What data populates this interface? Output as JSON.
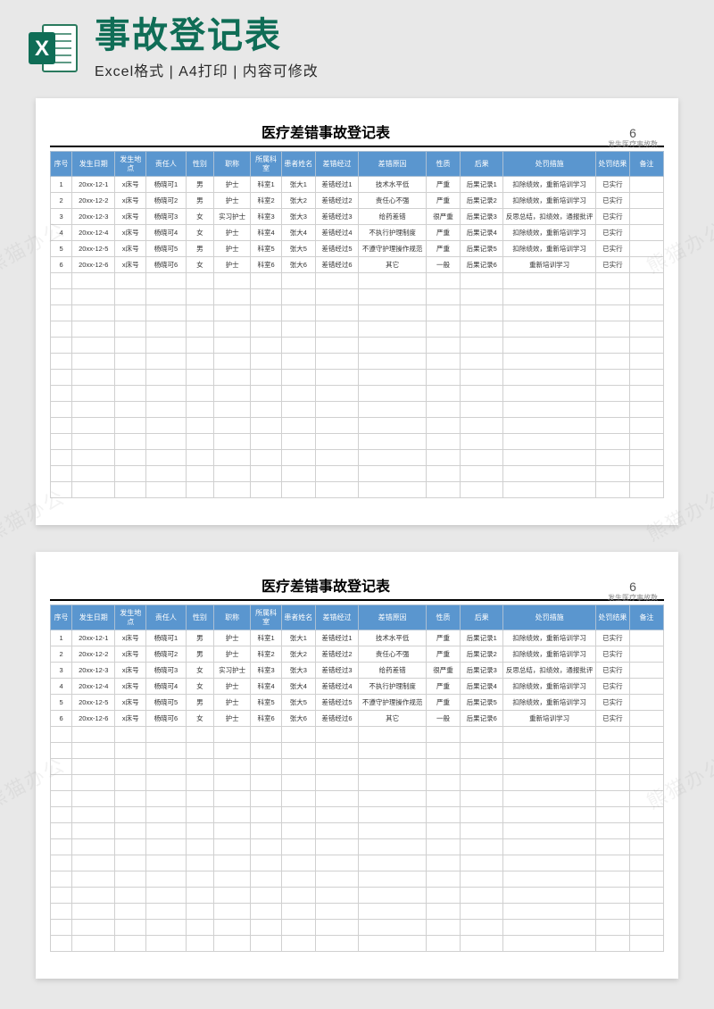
{
  "header": {
    "main_title": "事故登记表",
    "sub_title": "Excel格式 | A4打印 | 内容可修改",
    "excel_label": "X"
  },
  "sheet": {
    "title": "医疗差错事故登记表",
    "count_value": "6",
    "count_label": "发生医疗事故数"
  },
  "columns": {
    "seq": "序号",
    "date": "发生日期",
    "loc": "发生地点",
    "person": "责任人",
    "gender": "性别",
    "job": "职称",
    "dept": "所属科室",
    "patient": "患者姓名",
    "process": "差错经过",
    "reason": "差错原因",
    "nature": "性质",
    "result": "后果",
    "action": "处罚措施",
    "punres": "处罚结果",
    "note": "备注"
  },
  "rows": [
    {
      "seq": "1",
      "date": "20xx-12-1",
      "loc": "x床号",
      "person": "杨晓可1",
      "gender": "男",
      "job": "护士",
      "dept": "科室1",
      "patient": "张大1",
      "process": "差错经过1",
      "reason": "技术水平低",
      "nature": "严重",
      "result": "后果记录1",
      "action": "扣除绩效，重新培训学习",
      "punres": "已实行",
      "note": ""
    },
    {
      "seq": "2",
      "date": "20xx-12-2",
      "loc": "x床号",
      "person": "杨晓可2",
      "gender": "男",
      "job": "护士",
      "dept": "科室2",
      "patient": "张大2",
      "process": "差错经过2",
      "reason": "责任心不强",
      "nature": "严重",
      "result": "后果记录2",
      "action": "扣除绩效，重新培训学习",
      "punres": "已实行",
      "note": ""
    },
    {
      "seq": "3",
      "date": "20xx-12-3",
      "loc": "x床号",
      "person": "杨晓可3",
      "gender": "女",
      "job": "实习护士",
      "dept": "科室3",
      "patient": "张大3",
      "process": "差错经过3",
      "reason": "给药差错",
      "nature": "很严重",
      "result": "后果记录3",
      "action": "反思总结，扣绩效，通报批评",
      "punres": "已实行",
      "note": ""
    },
    {
      "seq": "4",
      "date": "20xx-12-4",
      "loc": "x床号",
      "person": "杨晓可4",
      "gender": "女",
      "job": "护士",
      "dept": "科室4",
      "patient": "张大4",
      "process": "差错经过4",
      "reason": "不执行护理制度",
      "nature": "严重",
      "result": "后果记录4",
      "action": "扣除绩效，重新培训学习",
      "punres": "已实行",
      "note": ""
    },
    {
      "seq": "5",
      "date": "20xx-12-5",
      "loc": "x床号",
      "person": "杨晓可5",
      "gender": "男",
      "job": "护士",
      "dept": "科室5",
      "patient": "张大5",
      "process": "差错经过5",
      "reason": "不遵守护理操作规范",
      "nature": "严重",
      "result": "后果记录5",
      "action": "扣除绩效，重新培训学习",
      "punres": "已实行",
      "note": ""
    },
    {
      "seq": "6",
      "date": "20xx-12-6",
      "loc": "x床号",
      "person": "杨晓可6",
      "gender": "女",
      "job": "护士",
      "dept": "科室6",
      "patient": "张大6",
      "process": "差错经过6",
      "reason": "其它",
      "nature": "一般",
      "result": "后果记录6",
      "action": "重新培训学习",
      "punres": "已实行",
      "note": ""
    }
  ],
  "empty_rows": 14,
  "watermark_text": "熊猫办公"
}
